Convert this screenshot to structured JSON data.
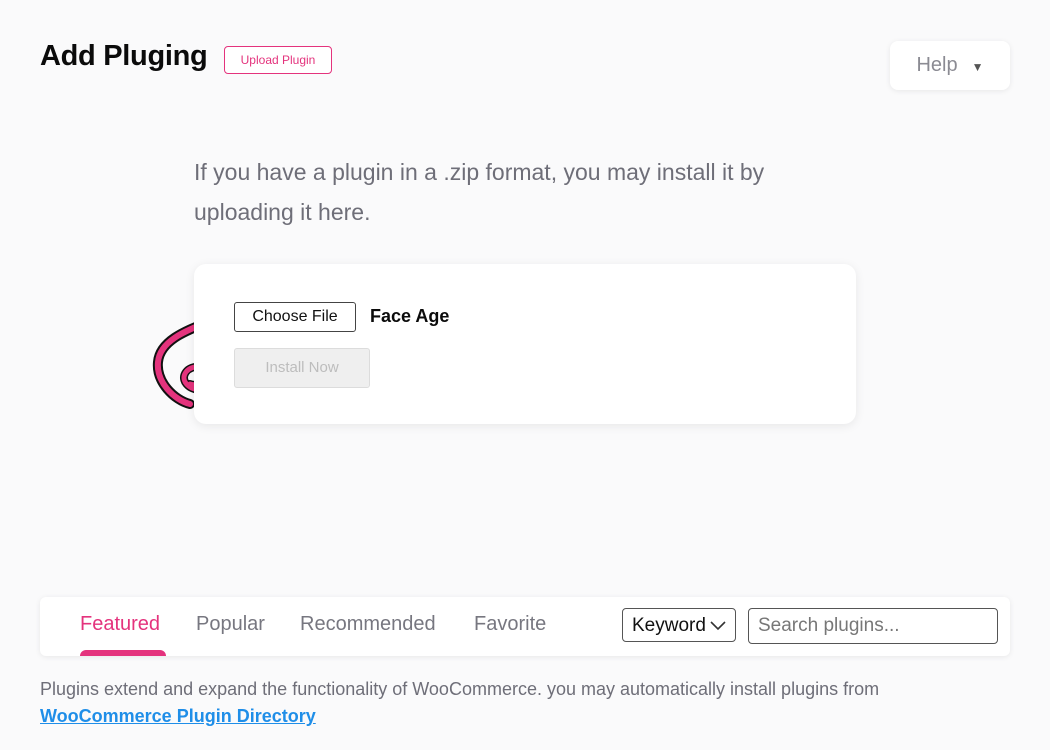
{
  "header": {
    "title": "Add Pluging",
    "upload_label": "Upload Plugin",
    "help_label": "Help"
  },
  "upload": {
    "intro_text": "If you have a plugin in a .zip format, you may install it by uploading it here.",
    "choose_file_label": "Choose File",
    "selected_file": "Face Age",
    "install_label": "Install Now"
  },
  "tabs": {
    "items": [
      {
        "label": "Featured",
        "active": true
      },
      {
        "label": "Popular",
        "active": false
      },
      {
        "label": "Recommended",
        "active": false
      },
      {
        "label": "Favorite",
        "active": false
      }
    ],
    "keyword_select": "Keyword",
    "search_placeholder": "Search plugins..."
  },
  "footer": {
    "text": "Plugins extend and expand the functionality of WooCommerce. you may automatically install plugins from",
    "link_label": "WooCommerce Plugin Directory"
  },
  "colors": {
    "accent": "#e4337d",
    "link": "#1f8ee8"
  },
  "icons": {
    "help_caret": "caret-down-icon",
    "keyword_chevron": "chevron-down-icon",
    "arrow": "curly-arrow-icon"
  }
}
